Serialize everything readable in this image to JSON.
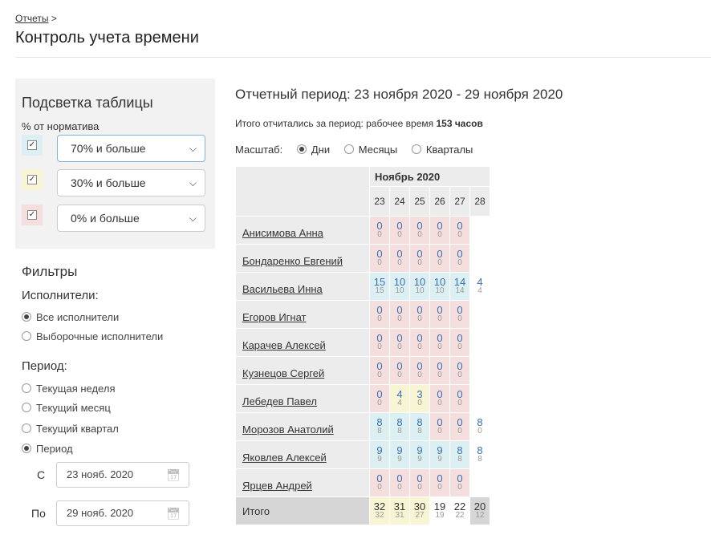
{
  "breadcrumb": {
    "link": "Отчеты",
    "sep": ">"
  },
  "title": "Контроль учета времени",
  "highlight": {
    "title": "Подсветка таблицы",
    "subtitle": "% от норматива",
    "rows": [
      {
        "value": "70% и больше",
        "color": "#dcf0f3"
      },
      {
        "value": "30% и больше",
        "color": "#f7f5d3"
      },
      {
        "value": "0% и больше",
        "color": "#f5dede"
      }
    ]
  },
  "filters": {
    "title": "Фильтры",
    "performers_label": "Исполнители:",
    "performers": [
      "Все исполнители",
      "Выборочные исполнители"
    ],
    "period_label": "Период:",
    "periods": [
      "Текущая неделя",
      "Текущий месяц",
      "Текущий квартал",
      "Период"
    ],
    "from_label": "С",
    "from_value": "23 нояб. 2020",
    "to_label": "По",
    "to_value": "29 нояб. 2020"
  },
  "report": {
    "period_title": "Отчетный период: 23 ноября 2020 - 29 ноября 2020",
    "total_prefix": "Итого отчитались за период: рабочее время ",
    "total_value": "153 часов",
    "scale_label": "Масштаб:",
    "scale_options": [
      "Дни",
      "Месяцы",
      "Кварталы"
    ],
    "month": "Ноябрь 2020",
    "days": [
      "23",
      "24",
      "25",
      "26",
      "27",
      "28"
    ],
    "total_label": "Итого"
  },
  "table": {
    "rows": [
      {
        "name": "Анисимова Анна",
        "cells": [
          [
            "0",
            "0",
            "red"
          ],
          [
            "0",
            "0",
            "red"
          ],
          [
            "0",
            "0",
            "red"
          ],
          [
            "0",
            "0",
            "red"
          ],
          [
            "0",
            "0",
            "red"
          ],
          [
            "",
            "",
            "none"
          ]
        ]
      },
      {
        "name": "Бондаренко Евгений",
        "cells": [
          [
            "0",
            "0",
            "red"
          ],
          [
            "0",
            "0",
            "red"
          ],
          [
            "0",
            "0",
            "red"
          ],
          [
            "0",
            "0",
            "red"
          ],
          [
            "0",
            "0",
            "red"
          ],
          [
            "",
            "",
            "none"
          ]
        ]
      },
      {
        "name": "Васильева Инна",
        "cells": [
          [
            "15",
            "15",
            "blue"
          ],
          [
            "10",
            "10",
            "blue"
          ],
          [
            "10",
            "10",
            "blue"
          ],
          [
            "10",
            "10",
            "blue"
          ],
          [
            "14",
            "14",
            "blue"
          ],
          [
            "4",
            "4",
            "none"
          ]
        ]
      },
      {
        "name": "Егоров Игнат",
        "cells": [
          [
            "0",
            "0",
            "red"
          ],
          [
            "0",
            "0",
            "red"
          ],
          [
            "0",
            "0",
            "red"
          ],
          [
            "0",
            "0",
            "red"
          ],
          [
            "0",
            "0",
            "red"
          ],
          [
            "",
            "",
            "none"
          ]
        ]
      },
      {
        "name": "Карачев Алексей",
        "cells": [
          [
            "0",
            "0",
            "red"
          ],
          [
            "0",
            "0",
            "red"
          ],
          [
            "0",
            "0",
            "red"
          ],
          [
            "0",
            "0",
            "red"
          ],
          [
            "0",
            "0",
            "red"
          ],
          [
            "",
            "",
            "none"
          ]
        ]
      },
      {
        "name": "Кузнецов Сергей",
        "cells": [
          [
            "0",
            "0",
            "red"
          ],
          [
            "0",
            "0",
            "red"
          ],
          [
            "0",
            "0",
            "red"
          ],
          [
            "0",
            "0",
            "red"
          ],
          [
            "0",
            "0",
            "red"
          ],
          [
            "",
            "",
            "none"
          ]
        ]
      },
      {
        "name": "Лебедев Павел",
        "cells": [
          [
            "0",
            "0",
            "red"
          ],
          [
            "4",
            "4",
            "yellow"
          ],
          [
            "3",
            "0",
            "yellow"
          ],
          [
            "0",
            "0",
            "red"
          ],
          [
            "0",
            "0",
            "red"
          ],
          [
            "",
            "",
            "none"
          ]
        ]
      },
      {
        "name": "Морозов Анатолий",
        "cells": [
          [
            "8",
            "8",
            "blue"
          ],
          [
            "8",
            "8",
            "blue"
          ],
          [
            "8",
            "8",
            "blue"
          ],
          [
            "0",
            "0",
            "red"
          ],
          [
            "0",
            "0",
            "red"
          ],
          [
            "8",
            "0",
            "none"
          ]
        ]
      },
      {
        "name": "Яковлев Алексей",
        "cells": [
          [
            "9",
            "9",
            "blue"
          ],
          [
            "9",
            "9",
            "blue"
          ],
          [
            "9",
            "9",
            "blue"
          ],
          [
            "9",
            "9",
            "blue"
          ],
          [
            "8",
            "8",
            "blue"
          ],
          [
            "8",
            "8",
            "none"
          ]
        ]
      },
      {
        "name": "Ярцев Андрей",
        "cells": [
          [
            "0",
            "0",
            "red"
          ],
          [
            "0",
            "0",
            "red"
          ],
          [
            "0",
            "0",
            "red"
          ],
          [
            "0",
            "0",
            "red"
          ],
          [
            "0",
            "0",
            "red"
          ],
          [
            "",
            "",
            "none"
          ]
        ]
      }
    ],
    "totals": [
      [
        "32",
        "32",
        "tot"
      ],
      [
        "31",
        "31",
        "tot"
      ],
      [
        "30",
        "27",
        "tot"
      ],
      [
        "19",
        "19",
        "tot plain"
      ],
      [
        "22",
        "22",
        "tot plain"
      ],
      [
        "20",
        "12",
        "tot grey"
      ]
    ]
  }
}
